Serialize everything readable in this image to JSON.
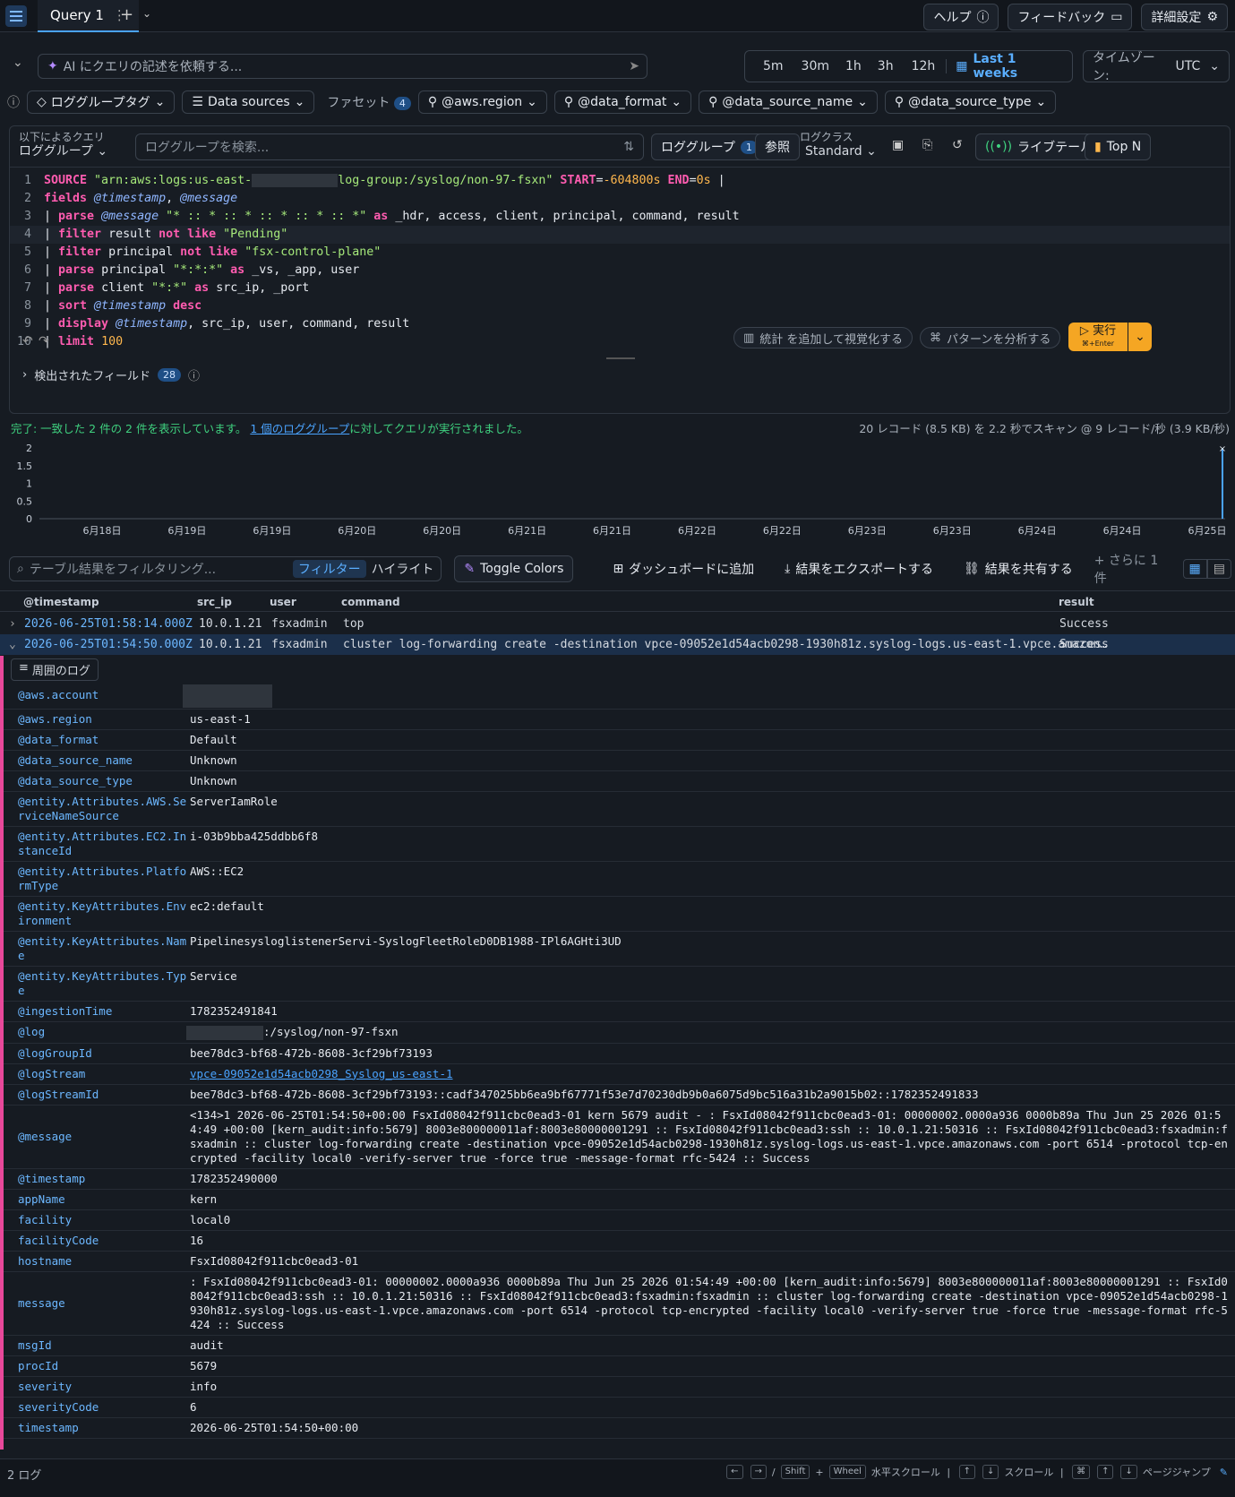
{
  "topbar": {
    "tab_label": "Query 1",
    "help": "ヘルプ",
    "feedback": "フィードバック",
    "settings": "詳細設定"
  },
  "ai": {
    "placeholder": "AI にクエリの記述を依頼する..."
  },
  "time": {
    "ranges": [
      "5m",
      "30m",
      "1h",
      "3h",
      "12h"
    ],
    "selected": "Last 1 weeks",
    "tz_label": "タイムゾーン:",
    "tz_value": "UTC"
  },
  "filters": {
    "loggroup_tag": "ロググループタグ",
    "data_sources": "Data sources",
    "facets_label": "ファセット",
    "facets_count": "4",
    "chips": [
      "@aws.region",
      "@data_format",
      "@data_source_name",
      "@data_source_type"
    ]
  },
  "qhead": {
    "query_by_label": "以下によるクエリ",
    "query_by_value": "ロググループ",
    "search_placeholder": "ロググループを検索...",
    "loggroup_btn": "ロググループ",
    "loggroup_count": "1",
    "browse": "参照",
    "class_label": "ログクラス",
    "class_value": "Standard",
    "live_tail": "ライブテール",
    "top_n": "Top N"
  },
  "query_lines": [
    {
      "n": "1",
      "tokens": [
        {
          "c": "kw",
          "t": "SOURCE "
        },
        {
          "c": "str",
          "t": "\"arn:aws:logs:us-east-"
        },
        {
          "c": "redact",
          "t": "            "
        },
        {
          "c": "str",
          "t": "log-group:/syslog/non-97-fsxn\" "
        },
        {
          "c": "kw",
          "t": "START"
        },
        {
          "c": "plain",
          "t": "="
        },
        {
          "c": "numc",
          "t": "-604800s "
        },
        {
          "c": "kw",
          "t": "END"
        },
        {
          "c": "plain",
          "t": "="
        },
        {
          "c": "numc",
          "t": "0s"
        },
        {
          "c": "plain",
          "t": " |"
        }
      ]
    },
    {
      "n": "2",
      "tokens": [
        {
          "c": "kw",
          "t": "fields "
        },
        {
          "c": "fld",
          "t": "@timestamp"
        },
        {
          "c": "plain",
          "t": ", "
        },
        {
          "c": "fld",
          "t": "@message"
        }
      ]
    },
    {
      "n": "3",
      "tokens": [
        {
          "c": "plain",
          "t": "| "
        },
        {
          "c": "kw",
          "t": "parse "
        },
        {
          "c": "fld",
          "t": "@message "
        },
        {
          "c": "str",
          "t": "\"* :: * :: * :: * :: * :: *\" "
        },
        {
          "c": "kw",
          "t": "as "
        },
        {
          "c": "plain",
          "t": "_hdr, access, client, principal, command, result"
        }
      ]
    },
    {
      "n": "4",
      "tokens": [
        {
          "c": "plain",
          "t": "| "
        },
        {
          "c": "kw",
          "t": "filter "
        },
        {
          "c": "plain",
          "t": "result "
        },
        {
          "c": "kw",
          "t": "not like "
        },
        {
          "c": "str",
          "t": "\"Pending\""
        }
      ]
    },
    {
      "n": "5",
      "tokens": [
        {
          "c": "plain",
          "t": "| "
        },
        {
          "c": "kw",
          "t": "filter "
        },
        {
          "c": "plain",
          "t": "principal "
        },
        {
          "c": "kw",
          "t": "not like "
        },
        {
          "c": "str",
          "t": "\"fsx-control-plane\""
        }
      ]
    },
    {
      "n": "6",
      "tokens": [
        {
          "c": "plain",
          "t": "| "
        },
        {
          "c": "kw",
          "t": "parse "
        },
        {
          "c": "plain",
          "t": "principal "
        },
        {
          "c": "str",
          "t": "\"*:*:*\" "
        },
        {
          "c": "kw",
          "t": "as "
        },
        {
          "c": "plain",
          "t": "_vs, _app, user"
        }
      ]
    },
    {
      "n": "7",
      "tokens": [
        {
          "c": "plain",
          "t": "| "
        },
        {
          "c": "kw",
          "t": "parse "
        },
        {
          "c": "plain",
          "t": "client "
        },
        {
          "c": "str",
          "t": "\"*:*\" "
        },
        {
          "c": "kw",
          "t": "as "
        },
        {
          "c": "plain",
          "t": "src_ip, _port"
        }
      ]
    },
    {
      "n": "8",
      "tokens": [
        {
          "c": "plain",
          "t": "| "
        },
        {
          "c": "kw",
          "t": "sort "
        },
        {
          "c": "fld",
          "t": "@timestamp "
        },
        {
          "c": "kw",
          "t": "desc"
        }
      ]
    },
    {
      "n": "9",
      "tokens": [
        {
          "c": "plain",
          "t": "| "
        },
        {
          "c": "kw",
          "t": "display "
        },
        {
          "c": "fld",
          "t": "@timestamp"
        },
        {
          "c": "plain",
          "t": ", src_ip, user, command, result"
        }
      ]
    },
    {
      "n": "10",
      "tokens": [
        {
          "c": "plain",
          "t": "| "
        },
        {
          "c": "kw",
          "t": "limit "
        },
        {
          "c": "numc",
          "t": "100"
        }
      ]
    }
  ],
  "editor_actions": {
    "visualize": "統計 を追加して視覚化する",
    "patterns": "パターンを分析する",
    "run": "実行",
    "run_hint": "⌘+Enter"
  },
  "discovered": {
    "label": "検出されたフィールド",
    "count": "28"
  },
  "status": {
    "done": "完了: 一致した 2 件の 2 件を表示しています。",
    "link": "1 個のロググループ",
    "link_suffix": "に対してクエリが実行されました。",
    "scan": "20 レコード (8.5 KB) を 2.2 秒でスキャン @ 9 レコード/秒 (3.9 KB/秒)"
  },
  "chart_data": {
    "type": "bar",
    "y_ticks": [
      "2",
      "1.5",
      "1",
      "0.5",
      "0"
    ],
    "x_ticks": [
      "6月18日",
      "6月19日",
      "6月19日",
      "6月20日",
      "6月20日",
      "6月21日",
      "6月21日",
      "6月22日",
      "6月22日",
      "6月23日",
      "6月23日",
      "6月24日",
      "6月24日",
      "6月25日"
    ],
    "ylim": [
      0,
      2
    ],
    "last_bucket_value": 2
  },
  "results_bar": {
    "filter_placeholder": "テーブル結果をフィルタリング...",
    "filter": "フィルター",
    "highlight": "ハイライト",
    "toggle_colors": "Toggle Colors",
    "dashboard": "ダッシュボードに追加",
    "export": "結果をエクスポートする",
    "share": "結果を共有する",
    "more": "+ さらに 1 件"
  },
  "table": {
    "headers": [
      "@timestamp",
      "src_ip",
      "user",
      "command",
      "result"
    ],
    "rows": [
      {
        "ts": "2026-06-25T01:58:14.000Z",
        "ip": "10.0.1.21",
        "user": "fsxadmin",
        "cmd": "top",
        "res": "Success"
      },
      {
        "ts": "2026-06-25T01:54:50.000Z",
        "ip": "10.0.1.21",
        "user": "fsxadmin",
        "cmd": "cluster log-forwarding create -destination vpce-09052e1d54acb0298-1930h81z.syslog-logs.us-east-1.vpce.amazon…",
        "res": "Success"
      }
    ]
  },
  "detail": {
    "surrounding": "周囲のログ",
    "fields": [
      {
        "k": "@aws.account",
        "v": ""
      },
      {
        "k": "@aws.region",
        "v": "us-east-1"
      },
      {
        "k": "@data_format",
        "v": "Default"
      },
      {
        "k": "@data_source_name",
        "v": "Unknown"
      },
      {
        "k": "@data_source_type",
        "v": "Unknown"
      },
      {
        "k": "@entity.Attributes.AWS.ServiceNameSource",
        "v": "ServerIamRole"
      },
      {
        "k": "@entity.Attributes.EC2.InstanceId",
        "v": "i-03b9bba425ddbb6f8"
      },
      {
        "k": "@entity.Attributes.PlatformType",
        "v": "AWS::EC2"
      },
      {
        "k": "@entity.KeyAttributes.Environment",
        "v": "ec2:default"
      },
      {
        "k": "@entity.KeyAttributes.Name",
        "v": "PipelinesysloglistenerServi-SyslogFleetRoleD0DB1988-IPl6AGHti3UD"
      },
      {
        "k": "@entity.KeyAttributes.Type",
        "v": "Service"
      },
      {
        "k": "@ingestionTime",
        "v": "1782352491841"
      },
      {
        "k": "@log",
        "v": ":/syslog/non-97-fsxn"
      },
      {
        "k": "@logGroupId",
        "v": "bee78dc3-bf68-472b-8608-3cf29bf73193"
      },
      {
        "k": "@logStream",
        "v": "vpce-09052e1d54acb0298_Syslog_us-east-1"
      },
      {
        "k": "@logStreamId",
        "v": "bee78dc3-bf68-472b-8608-3cf29bf73193::cadf347025bb6ea9bf67771f53e7d70230db9b0a6075d9bc516a31b2a9015b02::1782352491833"
      },
      {
        "k": "@message",
        "v": "<134>1 2026-06-25T01:54:50+00:00 FsxId08042f911cbc0ead3-01 kern 5679 audit - : FsxId08042f911cbc0ead3-01: 00000002.0000a936 0000b89a Thu Jun 25 2026 01:54:49 +00:00 [kern_audit:info:5679] 8003e800000011af:8003e80000001291 :: FsxId08042f911cbc0ead3:ssh :: 10.0.1.21:50316 :: FsxId08042f911cbc0ead3:fsxadmin:fsxadmin :: cluster log-forwarding create -destination vpce-09052e1d54acb0298-1930h81z.syslog-logs.us-east-1.vpce.amazonaws.com -port 6514 -protocol tcp-encrypted -facility local0 -verify-server true -force true -message-format rfc-5424 :: Success"
      },
      {
        "k": "@timestamp",
        "v": "1782352490000"
      },
      {
        "k": "appName",
        "v": "kern"
      },
      {
        "k": "facility",
        "v": "local0"
      },
      {
        "k": "facilityCode",
        "v": "16"
      },
      {
        "k": "hostname",
        "v": "FsxId08042f911cbc0ead3-01"
      },
      {
        "k": "message",
        "v": ": FsxId08042f911cbc0ead3-01: 00000002.0000a936 0000b89a Thu Jun 25 2026 01:54:49 +00:00 [kern_audit:info:5679] 8003e800000011af:8003e80000001291 :: FsxId08042f911cbc0ead3:ssh :: 10.0.1.21:50316 :: FsxId08042f911cbc0ead3:fsxadmin:fsxadmin :: cluster log-forwarding create -destination vpce-09052e1d54acb0298-1930h81z.syslog-logs.us-east-1.vpce.amazonaws.com -port 6514 -protocol tcp-encrypted -facility local0 -verify-server true -force true -message-format rfc-5424 :: Success"
      },
      {
        "k": "msgId",
        "v": "audit"
      },
      {
        "k": "procId",
        "v": "5679"
      },
      {
        "k": "severity",
        "v": "info"
      },
      {
        "k": "severityCode",
        "v": "6"
      },
      {
        "k": "timestamp",
        "v": "2026-06-25T01:54:50+00:00"
      }
    ]
  },
  "footer": {
    "count": "2 ログ",
    "hscroll": "水平スクロール",
    "scroll": "スクロール",
    "pagejump": "ページジャンプ",
    "shift": "Shift",
    "wheel": "Wheel"
  },
  "colors": {
    "accent": "#4aa3ff",
    "run": "#f5a623",
    "pink": "#e8489a",
    "success": "#3fd17f"
  }
}
